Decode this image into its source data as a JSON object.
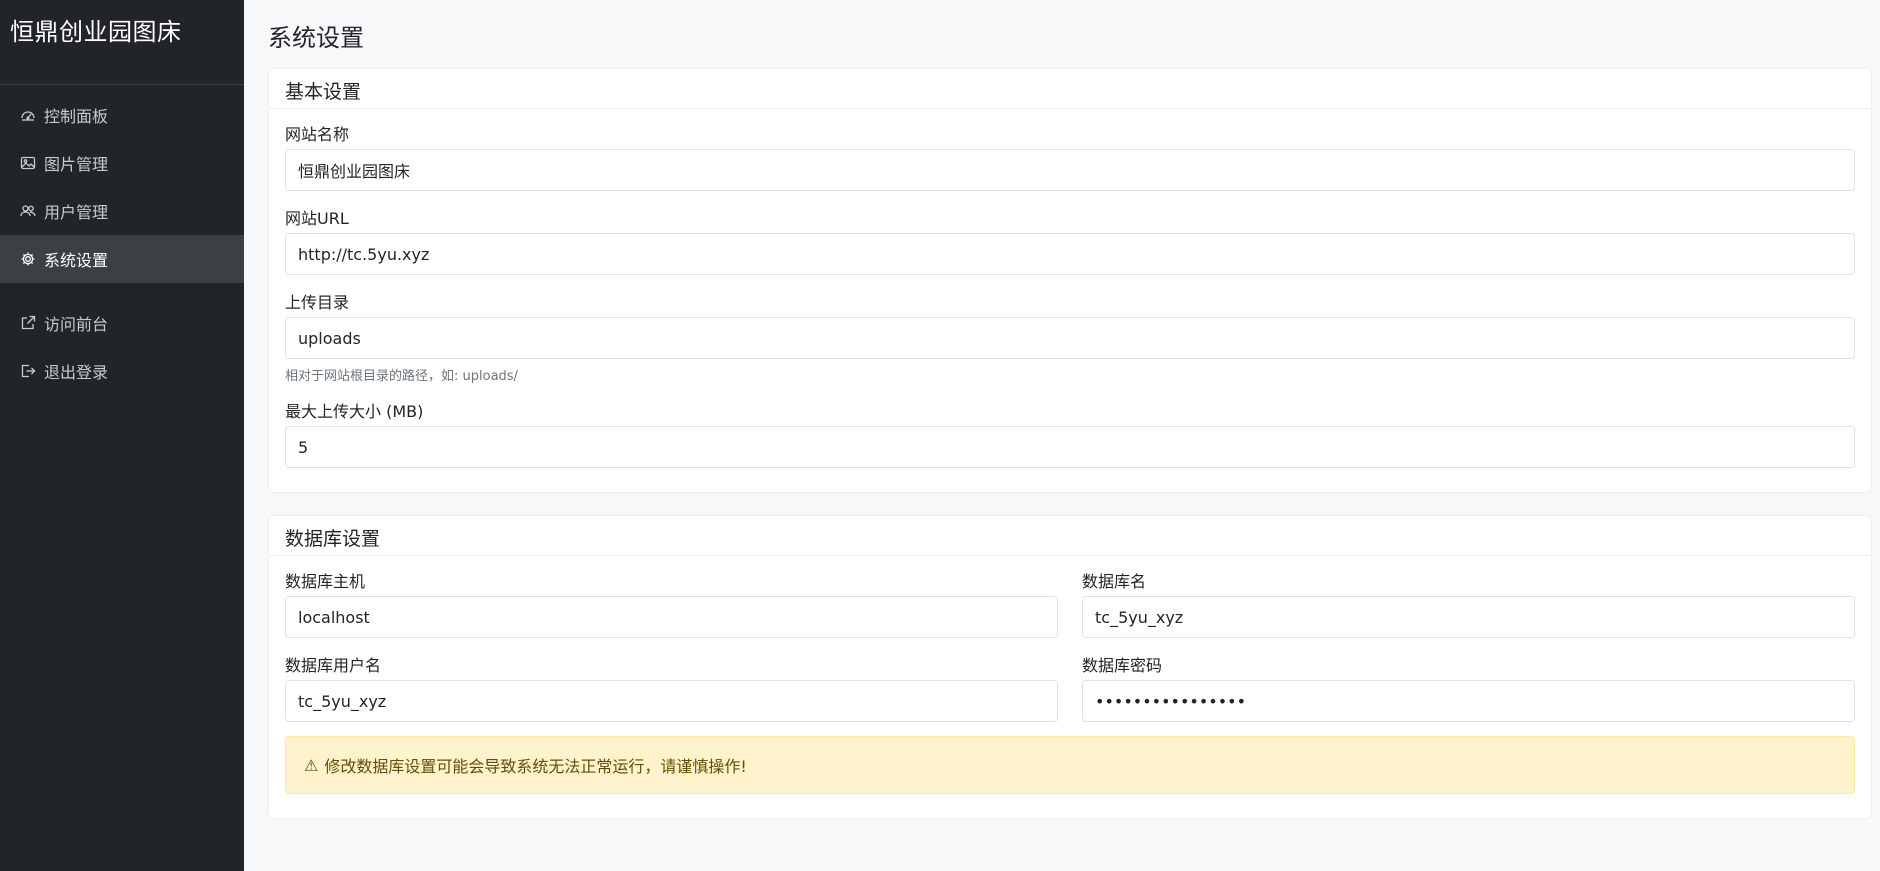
{
  "brand": "恒鼎创业园图床",
  "nav": [
    {
      "label": "控制面板",
      "icon": "dashboard-icon"
    },
    {
      "label": "图片管理",
      "icon": "image-icon"
    },
    {
      "label": "用户管理",
      "icon": "users-icon"
    },
    {
      "label": "系统设置",
      "icon": "gear-icon",
      "active": true
    },
    {
      "label": "访问前台",
      "icon": "external-link-icon"
    },
    {
      "label": "退出登录",
      "icon": "logout-icon"
    }
  ],
  "page_title": "系统设置",
  "basic": {
    "header": "基本设置",
    "site_name_label": "网站名称",
    "site_name_value": "恒鼎创业园图床",
    "site_url_label": "网站URL",
    "site_url_value": "http://tc.5yu.xyz",
    "upload_dir_label": "上传目录",
    "upload_dir_value": "uploads",
    "upload_dir_help": "相对于网站根目录的路径，如: uploads/",
    "max_upload_label": "最大上传大小 (MB)",
    "max_upload_value": "5"
  },
  "db": {
    "header": "数据库设置",
    "host_label": "数据库主机",
    "host_value": "localhost",
    "name_label": "数据库名",
    "name_value": "tc_5yu_xyz",
    "user_label": "数据库用户名",
    "user_value": "tc_5yu_xyz",
    "password_label": "数据库密码",
    "password_value": "••••••••••••••••",
    "warning": "修改数据库设置可能会导致系统无法正常运行，请谨慎操作!"
  }
}
